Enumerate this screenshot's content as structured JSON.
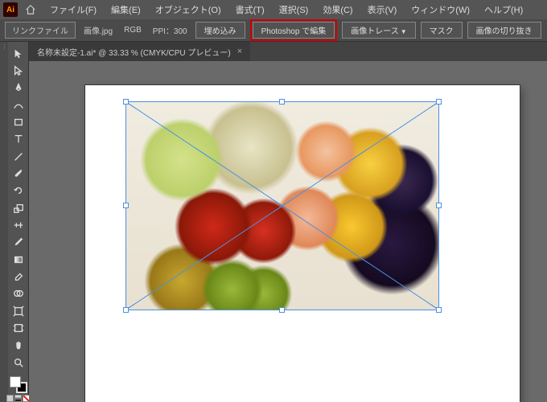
{
  "app": {
    "short": "Ai"
  },
  "menubar": {
    "items": [
      "ファイル(F)",
      "編集(E)",
      "オブジェクト(O)",
      "書式(T)",
      "選択(S)",
      "効果(C)",
      "表示(V)",
      "ウィンドウ(W)",
      "ヘルプ(H)"
    ]
  },
  "controlbar": {
    "link_file_label": "リンクファイル",
    "filename": "画像.jpg",
    "color_mode": "RGB",
    "ppi_label": "PPI：300",
    "embed_label": "埋め込み",
    "ps_edit_label": "Photoshop で編集",
    "trace_label": "画像トレース",
    "mask_label": "マスク",
    "crop_label": "画像の切り抜き"
  },
  "document": {
    "tab_text": "名称未設定-1.ai* @ 33.33 % (CMYK/CPU プレビュー)",
    "close_glyph": "×"
  },
  "tools": {
    "names": [
      "selection",
      "direct-selection",
      "pen",
      "curvature",
      "rectangle",
      "type",
      "line",
      "paintbrush",
      "rotate",
      "eyedropper",
      "scale",
      "gradient",
      "eraser",
      "width",
      "shape-builder",
      "free-transform",
      "artboard",
      "hand",
      "zoom"
    ]
  },
  "colors": {
    "highlight": "#d00000",
    "selection": "#4a90e2"
  }
}
